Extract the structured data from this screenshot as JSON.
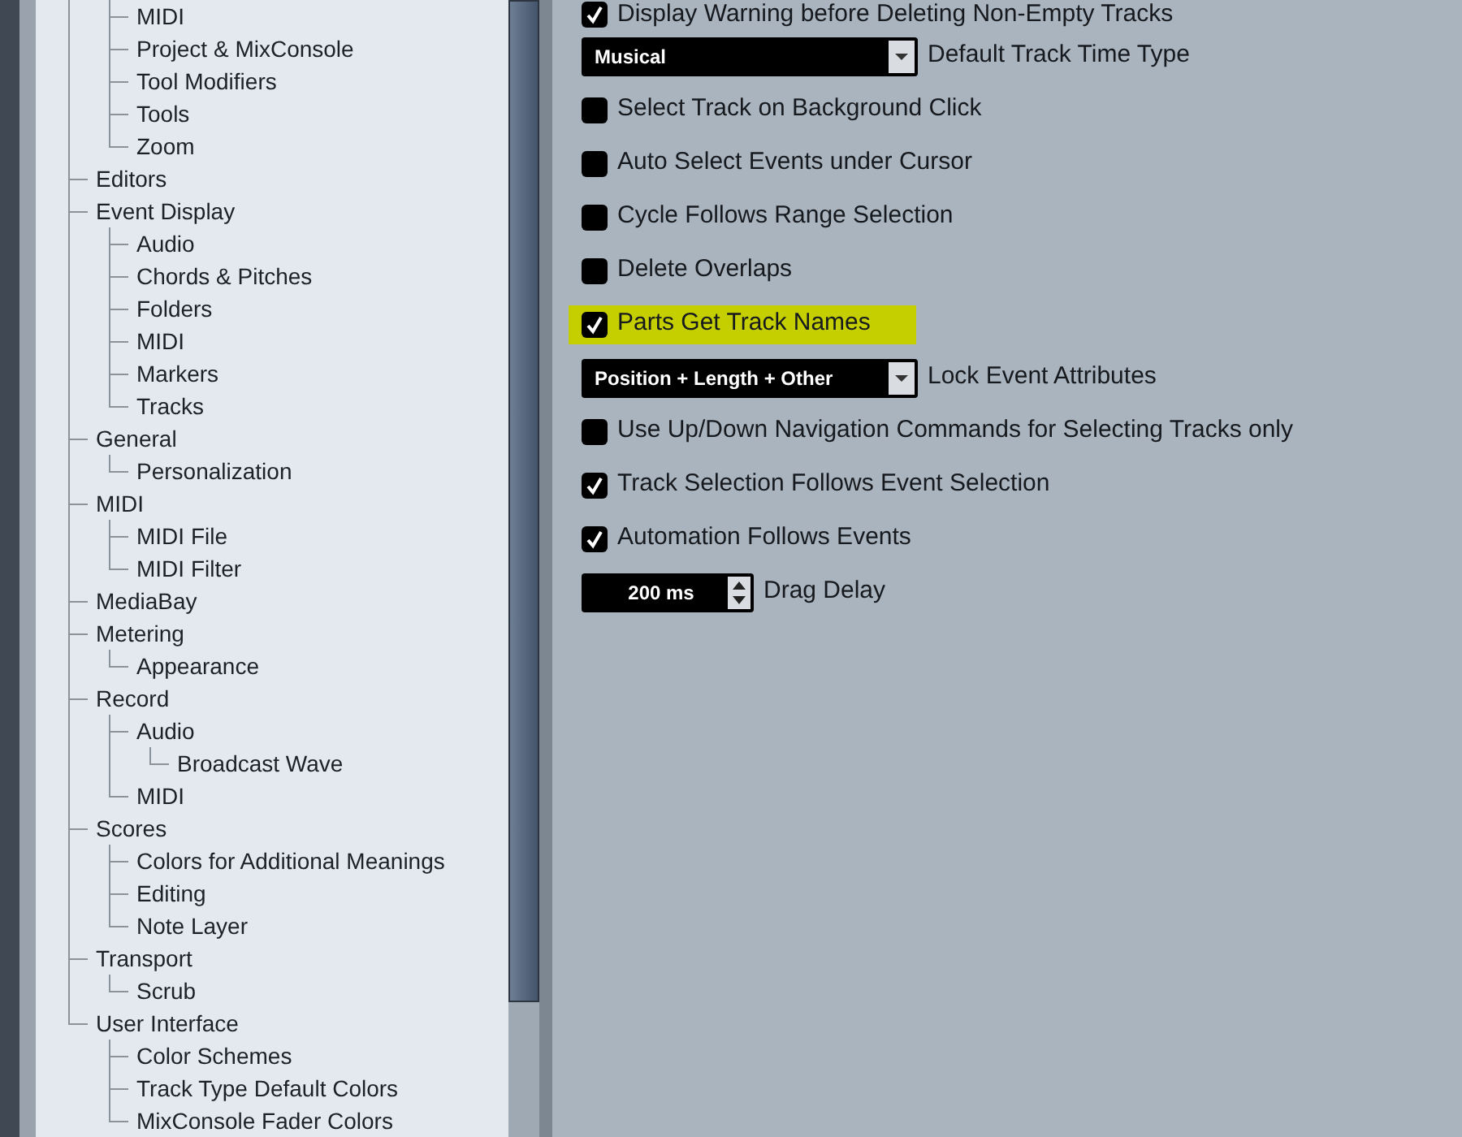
{
  "tree": [
    {
      "children": [
        {
          "label": "MIDI"
        },
        {
          "label": "Project & MixConsole"
        },
        {
          "label": "Tool Modifiers"
        },
        {
          "label": "Tools"
        },
        {
          "label": "Zoom"
        }
      ]
    },
    {
      "label": "Editors"
    },
    {
      "label": "Event Display",
      "children": [
        {
          "label": "Audio"
        },
        {
          "label": "Chords & Pitches"
        },
        {
          "label": "Folders"
        },
        {
          "label": "MIDI"
        },
        {
          "label": "Markers"
        },
        {
          "label": "Tracks"
        }
      ]
    },
    {
      "label": "General",
      "children": [
        {
          "label": "Personalization"
        }
      ]
    },
    {
      "label": "MIDI",
      "children": [
        {
          "label": "MIDI File"
        },
        {
          "label": "MIDI Filter"
        }
      ]
    },
    {
      "label": "MediaBay"
    },
    {
      "label": "Metering",
      "children": [
        {
          "label": "Appearance"
        }
      ]
    },
    {
      "label": "Record",
      "children": [
        {
          "label": "Audio",
          "children": [
            {
              "label": "Broadcast Wave"
            }
          ]
        },
        {
          "label": "MIDI"
        }
      ]
    },
    {
      "label": "Scores",
      "children": [
        {
          "label": "Colors for Additional Meanings"
        },
        {
          "label": "Editing"
        },
        {
          "label": "Note Layer"
        }
      ]
    },
    {
      "label": "Transport",
      "children": [
        {
          "label": "Scrub"
        }
      ]
    },
    {
      "label": "User Interface",
      "children": [
        {
          "label": "Color Schemes"
        },
        {
          "label": "Track Type Default Colors"
        },
        {
          "label": "MixConsole Fader Colors"
        }
      ]
    }
  ],
  "settings": [
    {
      "kind": "checkbox",
      "label": "Display Warning before Deleting Non-Empty Tracks",
      "checked": true,
      "highlighted": false
    },
    {
      "kind": "dropdown",
      "selection": "Musical",
      "label": "Default Track Time Type"
    },
    {
      "kind": "checkbox",
      "label": "Select Track on Background Click",
      "checked": false,
      "highlighted": false
    },
    {
      "kind": "checkbox",
      "label": "Auto Select Events under Cursor",
      "checked": false,
      "highlighted": false
    },
    {
      "kind": "checkbox",
      "label": "Cycle Follows Range Selection",
      "checked": false,
      "highlighted": false
    },
    {
      "kind": "checkbox",
      "label": "Delete Overlaps",
      "checked": false,
      "highlighted": false
    },
    {
      "kind": "checkbox",
      "label": "Parts Get Track Names",
      "checked": true,
      "highlighted": true
    },
    {
      "kind": "dropdown",
      "selection": "Position + Length + Other",
      "label": "Lock Event Attributes"
    },
    {
      "kind": "checkbox",
      "label": "Use Up/Down Navigation Commands for Selecting Tracks only",
      "checked": false,
      "highlighted": false
    },
    {
      "kind": "checkbox",
      "label": "Track Selection Follows Event Selection",
      "checked": true,
      "highlighted": false
    },
    {
      "kind": "checkbox",
      "label": "Automation Follows Events",
      "checked": true,
      "highlighted": false
    },
    {
      "kind": "spinbox",
      "entry": "200 ms",
      "label": "Drag Delay"
    }
  ]
}
